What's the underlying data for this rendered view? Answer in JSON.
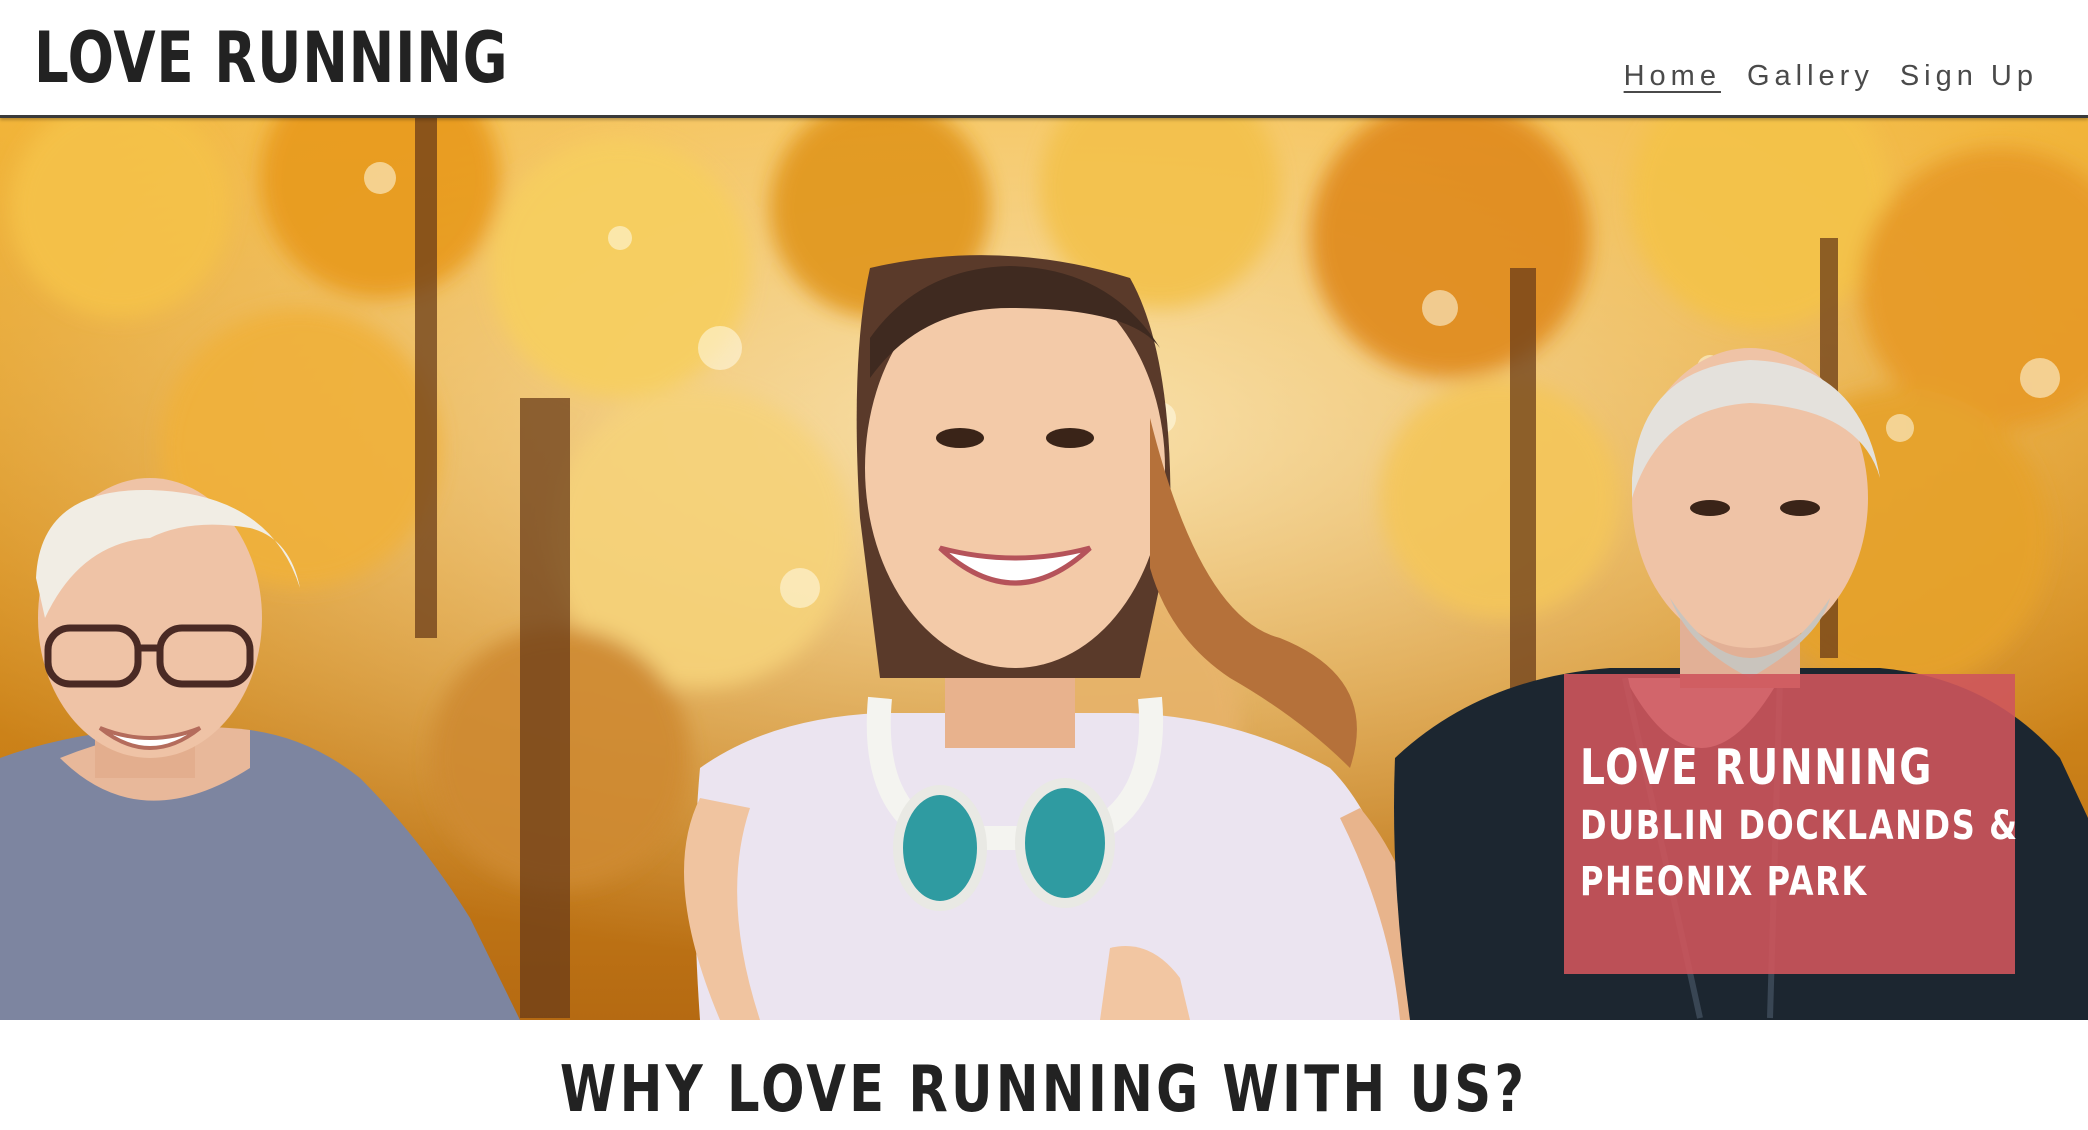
{
  "header": {
    "logo": "LOVE RUNNING",
    "nav": [
      {
        "label": "Home",
        "active": true
      },
      {
        "label": "Gallery",
        "active": false
      },
      {
        "label": "Sign Up",
        "active": false
      }
    ]
  },
  "hero": {
    "image_alt": "Three smiling people jogging through an autumn park with golden trees",
    "card": {
      "title": "LOVE RUNNING",
      "subtitle_line1": "DUBLIN DOCKLANDS &",
      "subtitle_line2": "PHEONIX PARK"
    }
  },
  "section": {
    "title": "WHY LOVE RUNNING WITH US?"
  },
  "colors": {
    "card_overlay": "#ce555c",
    "logo_text": "#222222",
    "nav_text": "#4a4a4a",
    "foliage": "#e3a21e"
  }
}
